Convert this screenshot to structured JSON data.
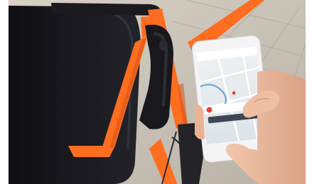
{
  "photo": {
    "colors": {
      "frame_orange": "#ff6d1f",
      "battery_black": "#141418",
      "pavement": "#c9c2b7",
      "map_blue": "#6fa8d6",
      "accent_red": "#e8432f",
      "button_dark": "#3f4654",
      "skin": "#eeb99c"
    },
    "icons": [
      "bike-lock-icon",
      "map-pin-icon"
    ]
  },
  "phone_screen": {
    "top_bar_text": "",
    "station_label": "",
    "primary_button_label": "",
    "secondary_link_label": ""
  }
}
